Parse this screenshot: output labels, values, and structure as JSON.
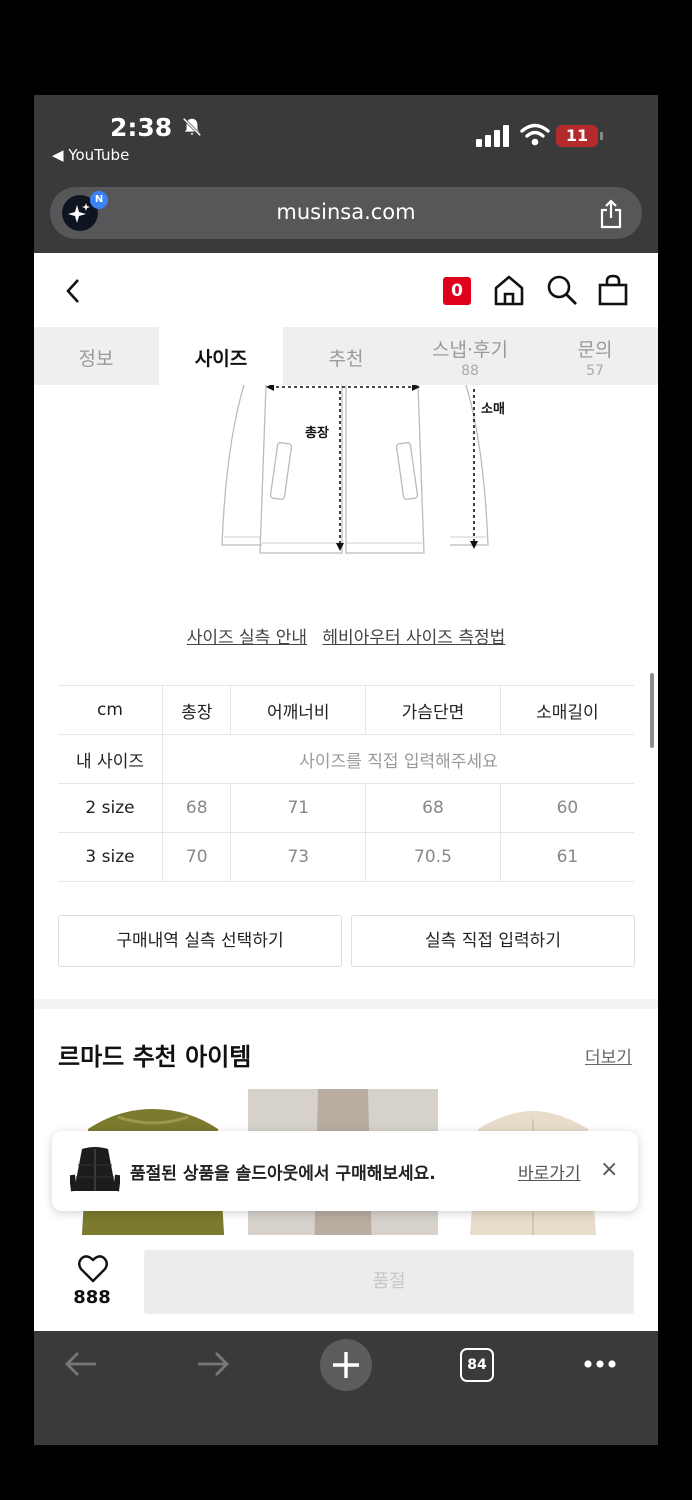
{
  "status_bar": {
    "time": "2:38",
    "back_app": "YouTube",
    "battery": "11"
  },
  "browser": {
    "url": "musinsa.com",
    "profile_badge": "N",
    "tab_count": "84"
  },
  "header": {
    "cart_count": "0"
  },
  "tabs": [
    {
      "label": "정보",
      "count": ""
    },
    {
      "label": "사이즈",
      "count": ""
    },
    {
      "label": "추천",
      "count": ""
    },
    {
      "label": "스냅·후기",
      "count": "88"
    },
    {
      "label": "문의",
      "count": "57"
    }
  ],
  "diagram": {
    "length_label": "총장",
    "sleeve_label": "소매길이"
  },
  "size_links": {
    "guide": "사이즈 실측 안내",
    "measure": "헤비아우터 사이즈 측정법"
  },
  "size_table": {
    "unit": "cm",
    "headers": [
      "총장",
      "어깨너비",
      "가슴단면",
      "소매길이"
    ],
    "my_size_label": "내 사이즈",
    "my_size_placeholder": "사이즈를 직접 입력해주세요",
    "rows": [
      {
        "label": "2 size",
        "values": [
          "68",
          "71",
          "68",
          "60"
        ]
      },
      {
        "label": "3 size",
        "values": [
          "70",
          "73",
          "70.5",
          "61"
        ]
      }
    ]
  },
  "buttons": {
    "purchase_history": "구매내역 실측 선택하기",
    "direct_input": "실측 직접 입력하기"
  },
  "recommend": {
    "title": "르마드 추천 아이템",
    "more": "더보기"
  },
  "toast": {
    "message": "품절된 상품을 솔드아웃에서 구매해보세요.",
    "link": "바로가기",
    "close": "×"
  },
  "bottom": {
    "like_count": "888",
    "buy_label": "품절"
  }
}
